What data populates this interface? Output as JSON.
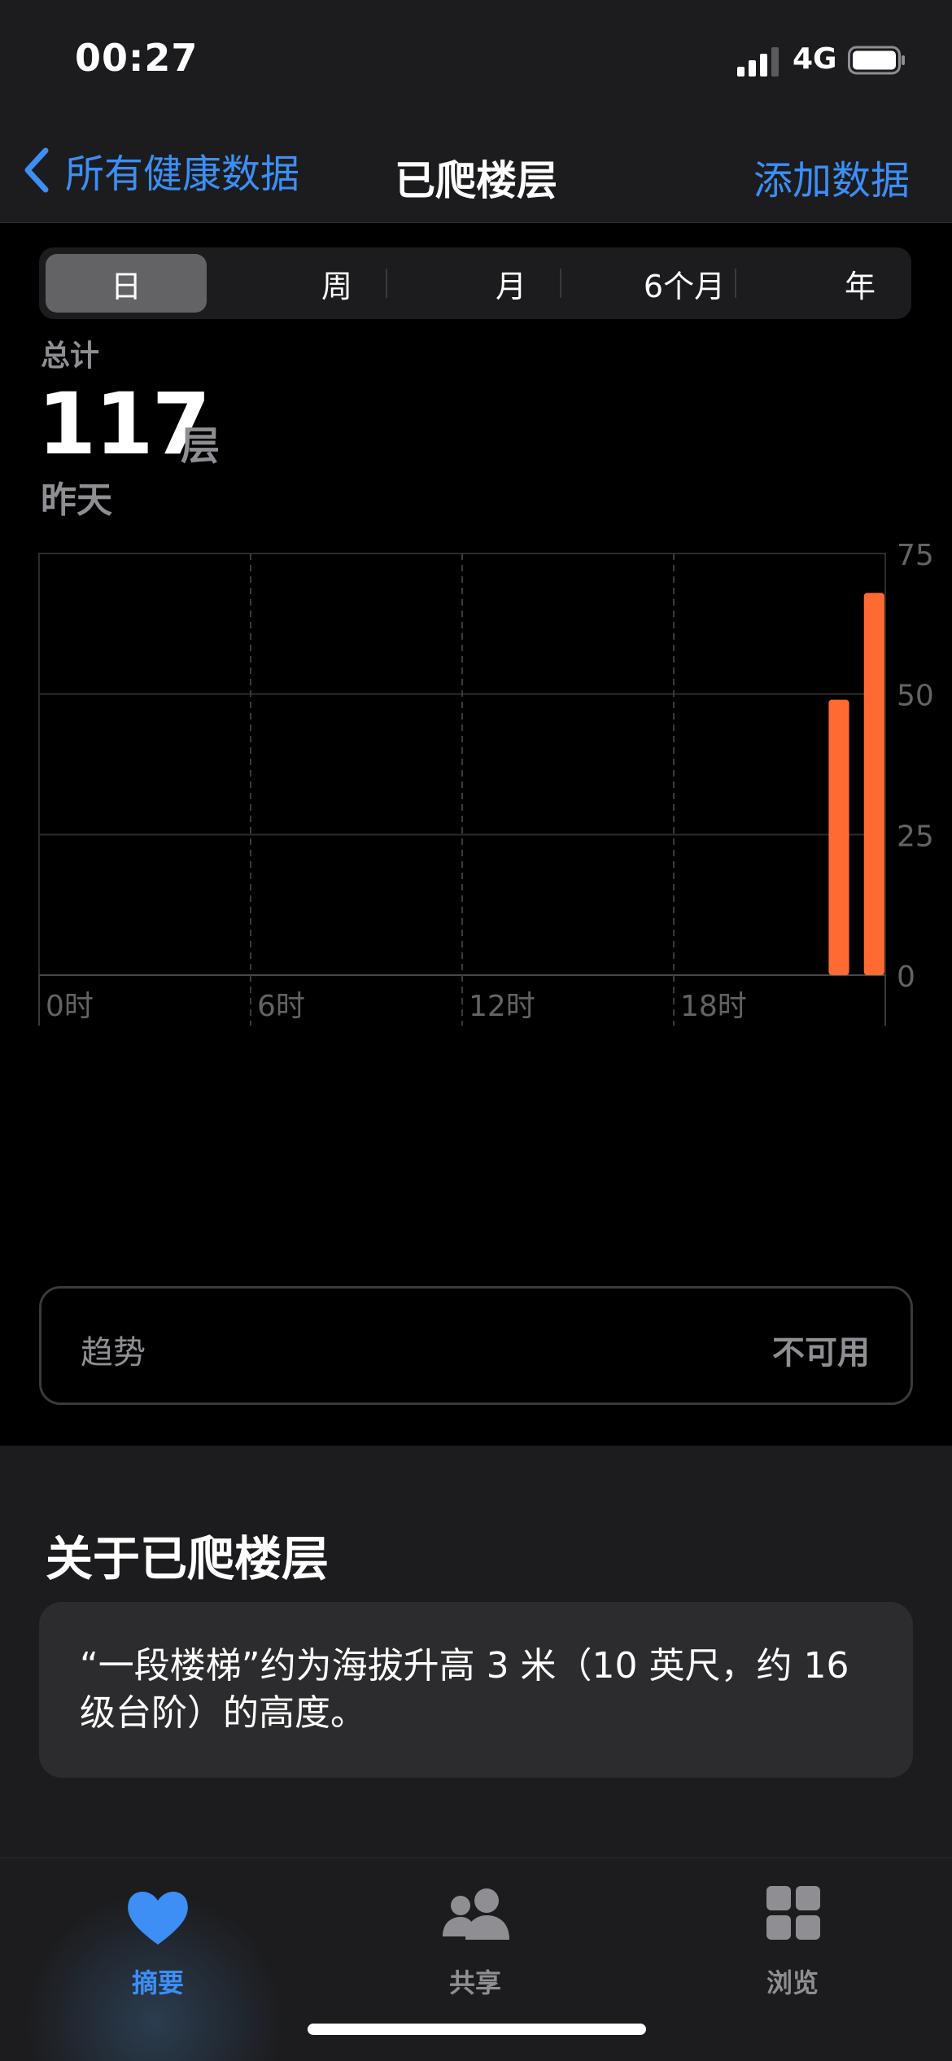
{
  "status_bar": {
    "time": "00:27",
    "network": "4G",
    "icons": [
      "signal-icon",
      "battery-icon"
    ]
  },
  "nav": {
    "back_label": "所有健康数据",
    "title": "已爬楼层",
    "action_label": "添加数据",
    "back_icon": "chevron-left-icon"
  },
  "segments": [
    {
      "label": "日",
      "active": true
    },
    {
      "label": "周",
      "active": false
    },
    {
      "label": "月",
      "active": false
    },
    {
      "label": "6个月",
      "active": false
    },
    {
      "label": "年",
      "active": false
    }
  ],
  "summary": {
    "label": "总计",
    "value": "117",
    "unit": "层",
    "date": "昨天"
  },
  "chart_data": {
    "type": "bar",
    "x_tick_labels": [
      "0时",
      "6时",
      "12时",
      "18时"
    ],
    "y_tick_labels": [
      "75",
      "50",
      "25",
      "0"
    ],
    "ylim": [
      0,
      75
    ],
    "xlim": [
      0,
      24
    ],
    "grid": true,
    "bar_color": "#ff6a32",
    "series": [
      {
        "values": [
          {
            "hour": 22,
            "floors": 49
          },
          {
            "hour": 23,
            "floors": 68
          }
        ]
      }
    ]
  },
  "trend": {
    "label": "趋势",
    "value": "不可用"
  },
  "about": {
    "title": "关于已爬楼层",
    "text": "“一段楼梯”约为海拔升高 3 米（10 英尺，约 16 级台阶）的高度。"
  },
  "tabbar": {
    "tabs": [
      {
        "label": "摘要",
        "icon": "heart-icon",
        "active": true
      },
      {
        "label": "共享",
        "icon": "people-icon",
        "active": false
      },
      {
        "label": "浏览",
        "icon": "grid-icon",
        "active": false
      }
    ]
  },
  "colors": {
    "accent": "#3d8ef5",
    "bar": "#ff6a32",
    "background": "#000000",
    "surface": "#1c1c1e"
  }
}
